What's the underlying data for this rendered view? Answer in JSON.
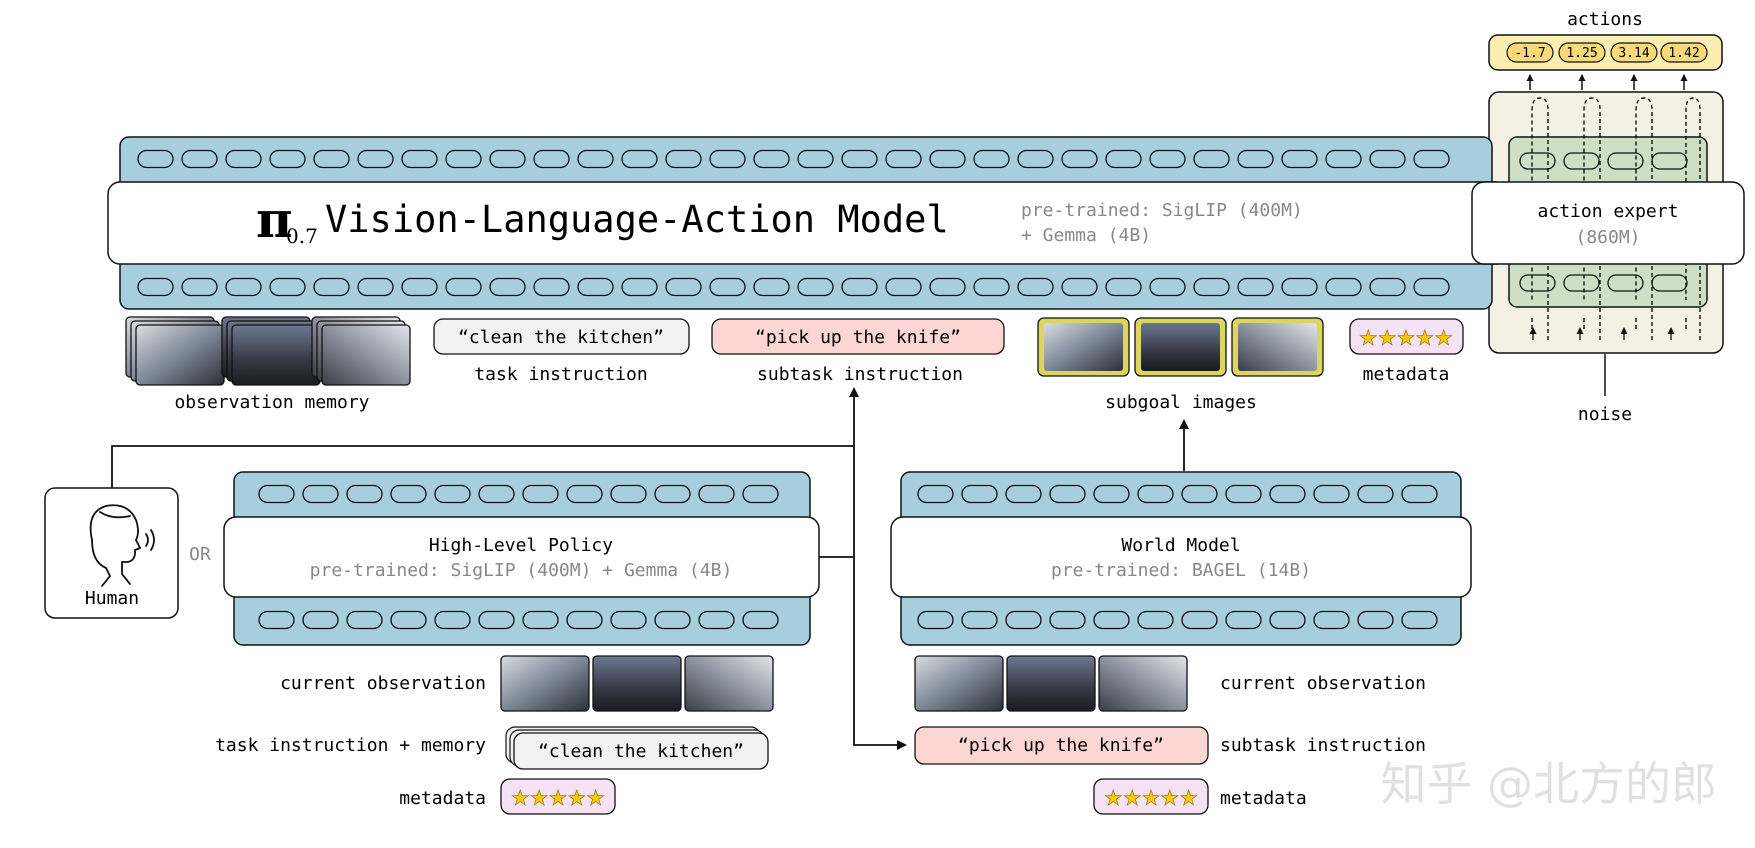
{
  "vla": {
    "pi_symbol": "π",
    "pi_version": "0.7",
    "title": "Vision-Language-Action Model",
    "pretrained_line1": "pre-trained: SigLIP (400M)",
    "pretrained_line2": "+ Gemma (4B)"
  },
  "action_expert": {
    "title": "action expert",
    "size": "(860M)"
  },
  "actions": {
    "label": "actions",
    "values": [
      "-1.7",
      "1.25",
      "3.14",
      "1.42"
    ]
  },
  "noise_label": "noise",
  "vla_inputs": {
    "observation_memory_label": "observation memory",
    "task_instruction_text": "“clean the kitchen”",
    "task_instruction_label": "task instruction",
    "subtask_instruction_text": "“pick up the knife”",
    "subtask_instruction_label": "subtask instruction",
    "subgoal_images_label": "subgoal images",
    "metadata_label": "metadata",
    "metadata_stars": "★★★★★"
  },
  "human": {
    "label": "Human",
    "or_label": "OR"
  },
  "high_level_policy": {
    "title": "High-Level Policy",
    "pretrained": "pre-trained: SigLIP (400M) + Gemma (4B)",
    "current_observation_label": "current observation",
    "task_memory_label": "task instruction + memory",
    "task_text": "“clean the kitchen”",
    "metadata_label": "metadata"
  },
  "world_model": {
    "title": "World Model",
    "pretrained": "pre-trained: BAGEL (14B)",
    "current_observation_label": "current observation",
    "subtask_text": "“pick up the knife”",
    "subtask_label": "subtask instruction",
    "metadata_label": "metadata"
  },
  "watermark": "知乎 @北方的郎",
  "colors": {
    "token_band": "#a6cedd",
    "token_stroke": "#111111",
    "action_expert_bg": "#f3f1e3",
    "action_expert_inner": "#cde0c4",
    "actions_bg": "#fbeeb0",
    "subtask_pink": "#fcd6d2",
    "metadata_bg": "#f6e1f6",
    "star": "#f6c90e",
    "subgoal_frame": "#dcd55e"
  }
}
